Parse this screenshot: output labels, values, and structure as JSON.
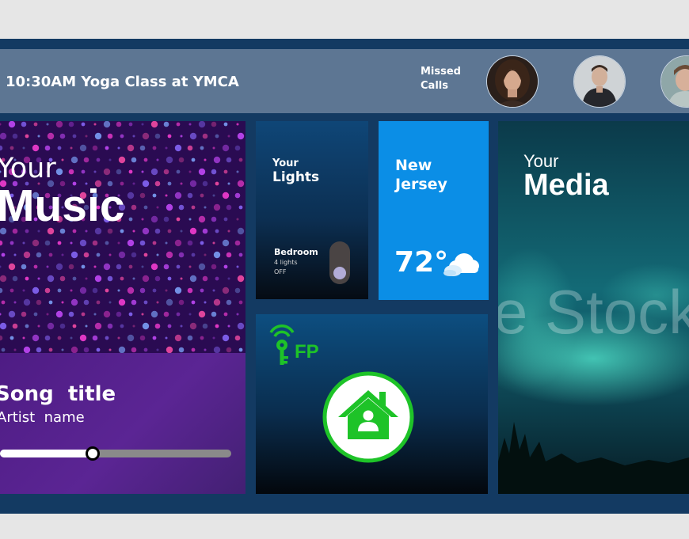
{
  "topbar": {
    "event_text": "10:30AM Yoga Class at YMCA",
    "missed_calls_label": "Missed Calls",
    "avatars": [
      "woman-avatar",
      "man-avatar",
      "person-avatar"
    ]
  },
  "music": {
    "your_label": "Your",
    "title": "Music",
    "song_title": "Song  title",
    "artist_name": "Artist  name",
    "progress": 0.4
  },
  "lights": {
    "your_label": "Your",
    "title": "Lights",
    "room": "Bedroom",
    "count": "4 lights",
    "state": "OFF"
  },
  "weather": {
    "city": "New Jersey",
    "temperature": "72°",
    "icon": "partly-cloudy-icon"
  },
  "home": {
    "logo_text": "FP",
    "logo_icon": "key-wifi-icon",
    "button_icon": "home-icon"
  },
  "media": {
    "your_label": "Your",
    "title": "Media",
    "watermark": "e Stock"
  },
  "colors": {
    "frame": "#133a62",
    "topbar": "#5d7693",
    "weather": "#0b8ee6",
    "accent_green": "#1ec328"
  }
}
